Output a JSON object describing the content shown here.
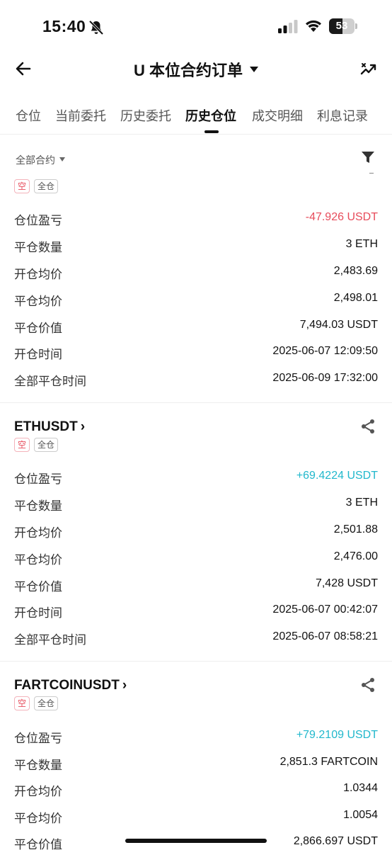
{
  "status_bar": {
    "time": "15:40",
    "battery_level": 53,
    "battery_text": "53",
    "icons": [
      "bell-slash-icon",
      "signal-icon",
      "wifi-icon",
      "battery-icon"
    ]
  },
  "nav": {
    "title": "U 本位合约订单",
    "back_icon": "arrow-left-icon",
    "action_icon": "chart-share-icon"
  },
  "tabs": [
    {
      "label": "仓位"
    },
    {
      "label": "当前委托"
    },
    {
      "label": "历史委托"
    },
    {
      "label": "历史仓位",
      "active": true
    },
    {
      "label": "成交明细"
    },
    {
      "label": "利息记录"
    }
  ],
  "filter": {
    "label": "全部合约",
    "icon": "funnel-icon"
  },
  "row_labels": {
    "pnl": "仓位盈亏",
    "close_qty": "平仓数量",
    "open_avg": "开仓均价",
    "close_avg": "平仓均价",
    "close_value": "平仓价值",
    "open_time": "开仓时间",
    "close_time": "全部平仓时间"
  },
  "positions": [
    {
      "symbol": "",
      "side_tag": "空",
      "margin_tag": "全仓",
      "pnl": "-47.926 USDT",
      "close_qty": "3 ETH",
      "open_avg": "2,483.69",
      "close_avg": "2,498.01",
      "close_value": "7,494.03 USDT",
      "open_time": "2025-06-07 12:09:50",
      "close_time": "2025-06-09 17:32:00"
    },
    {
      "symbol": "ETHUSDT",
      "side_tag": "空",
      "margin_tag": "全仓",
      "pnl": "+69.4224 USDT",
      "close_qty": "3 ETH",
      "open_avg": "2,501.88",
      "close_avg": "2,476.00",
      "close_value": "7,428 USDT",
      "open_time": "2025-06-07 00:42:07",
      "close_time": "2025-06-07 08:58:21"
    },
    {
      "symbol": "FARTCOINUSDT",
      "side_tag": "空",
      "margin_tag": "全仓",
      "pnl": "+79.2109 USDT",
      "close_qty": "2,851.3 FARTCOIN",
      "open_avg": "1.0344",
      "close_avg": "1.0054",
      "close_value": "2,866.697 USDT"
    }
  ],
  "colors": {
    "loss": "#e74c5b",
    "profit": "#21b8cc",
    "text": "#111111"
  }
}
